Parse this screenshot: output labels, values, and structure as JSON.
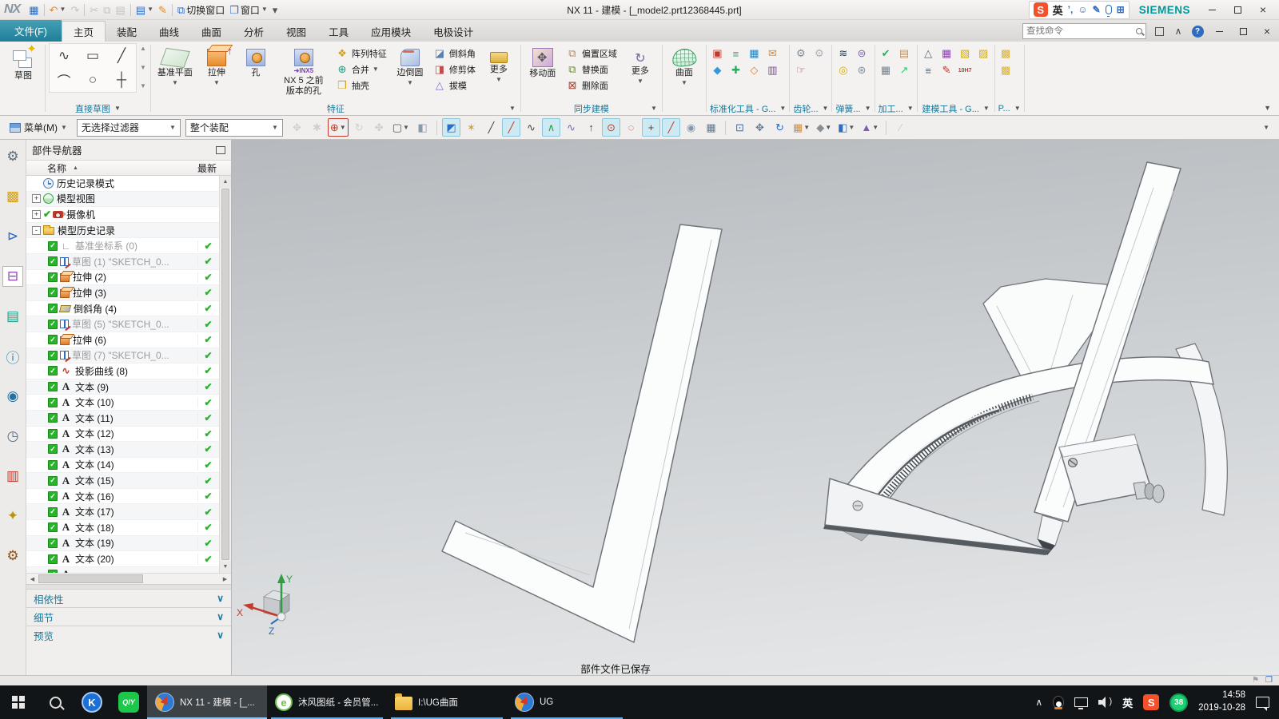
{
  "title_bar": {
    "logo": "NX",
    "title": "NX 11 - 建模 - [_model2.prt12368445.prt]",
    "qat": [
      {
        "name": "save-button",
        "glyph": "▦",
        "color": "#2d6cc0"
      },
      {
        "name": "sep"
      },
      {
        "name": "undo-button",
        "glyph": "↶",
        "color": "#e08a2e",
        "caret": true
      },
      {
        "name": "redo-button",
        "glyph": "↷",
        "color": "#888",
        "dim": true
      },
      {
        "name": "sep"
      },
      {
        "name": "cut-button",
        "glyph": "✂",
        "color": "#888",
        "dim": true
      },
      {
        "name": "copy-button",
        "glyph": "⧉",
        "color": "#888",
        "dim": true
      },
      {
        "name": "paste-button",
        "glyph": "▤",
        "color": "#888",
        "dim": true
      },
      {
        "name": "sep"
      },
      {
        "name": "format-painter-button",
        "glyph": "▤",
        "color": "#2d6cc0",
        "caret": true
      },
      {
        "name": "sweep-button",
        "glyph": "✎",
        "color": "#e08a2e"
      },
      {
        "name": "sep"
      },
      {
        "name": "switch-window-button",
        "glyph": "⧉",
        "color": "#2d6cc0",
        "label": "切换窗口"
      },
      {
        "name": "window-button",
        "glyph": "❒",
        "color": "#2d6cc0",
        "label": "窗口",
        "caret": true
      },
      {
        "name": "qat-overflow-button",
        "glyph": "▾",
        "color": "#555"
      }
    ],
    "ime": {
      "sogou": "S",
      "lang": "英",
      "punct": "’,",
      "smiley": "☺",
      "pen": "✎",
      "grid": "⊞"
    },
    "brand": "SIEMENS"
  },
  "ribbon_tabs": [
    {
      "label": "文件(F)",
      "file": true
    },
    {
      "label": "主页",
      "active": true
    },
    {
      "label": "装配"
    },
    {
      "label": "曲线"
    },
    {
      "label": "曲面"
    },
    {
      "label": "分析"
    },
    {
      "label": "视图"
    },
    {
      "label": "工具"
    },
    {
      "label": "应用模块"
    },
    {
      "label": "电极设计"
    }
  ],
  "find_command": {
    "placeholder": "查找命令"
  },
  "ribbon": {
    "sketch": {
      "label": "草图",
      "group": "直接草图",
      "cells": [
        "∿",
        "▭",
        "╱",
        "⌒",
        "○",
        "┼"
      ]
    },
    "feature": {
      "datum_plane": "基准平面",
      "extrude": "拉伸",
      "hole": "孔",
      "legacy_hole": "NX 5 之前 版本的孔",
      "legacy_tag": "➜INX5",
      "pattern": "阵列特征",
      "unite": "合并",
      "shell": "抽壳",
      "edge_blend": "边倒圆",
      "chamfer": "倒斜角",
      "trim_body": "修剪体",
      "draft": "拔模",
      "more": "更多",
      "label": "特征"
    },
    "sync": {
      "move_face": "移动面",
      "offset_region": "偏置区域",
      "replace_face": "替换面",
      "delete_face": "删除面",
      "more": "更多",
      "label": "同步建模"
    },
    "surface": {
      "label": "曲面"
    },
    "toolbox": [
      {
        "name": "standard-tools-group",
        "label": "标准化工具 - G...",
        "rows": [
          [
            [
              "▣",
              "#c0392b"
            ],
            [
              "≡",
              "#27ae60"
            ],
            [
              "▦",
              "#2980b9"
            ],
            [
              "✉",
              "#d2883a"
            ]
          ],
          [
            [
              "◆",
              "#3498db"
            ],
            [
              "✚",
              "#27ae60"
            ],
            [
              "◇",
              "#e67e22"
            ],
            [
              "▥",
              "#8e44ad"
            ]
          ]
        ]
      },
      {
        "name": "gear-group",
        "label": "齿轮...",
        "rows": [
          [
            [
              "⚙",
              "#808b96"
            ],
            [
              "⚙",
              "#aab4bd"
            ]
          ],
          [
            [
              "☞",
              "#b03a2e"
            ]
          ]
        ]
      },
      {
        "name": "spring-group",
        "label": "弹簧...",
        "rows": [
          [
            [
              "≋",
              "#2e4053"
            ],
            [
              "⊜",
              "#7d5fb2"
            ]
          ],
          [
            [
              "◎",
              "#d4ac0d"
            ],
            [
              "⊛",
              "#85929e"
            ]
          ]
        ]
      },
      {
        "name": "machining-group",
        "label": "加工...",
        "rows": [
          [
            [
              "✔",
              "#27ae60"
            ],
            [
              "▤",
              "#b9946f"
            ]
          ],
          [
            [
              "▦",
              "#76848f"
            ],
            [
              "↗",
              "#2ecc71"
            ]
          ]
        ]
      },
      {
        "name": "modeling-tools-group",
        "label": "建模工具 - G...",
        "rows": [
          [
            [
              "△",
              "#566573"
            ],
            [
              "▦",
              "#8e44ad"
            ],
            [
              "▧",
              "#d4ac0d"
            ],
            [
              "▨",
              "#d4ac0d"
            ]
          ],
          [
            [
              "≡",
              "#566573"
            ],
            [
              "✎",
              "#b03a2e"
            ],
            [
              "10H7",
              "#c0392b",
              "txt"
            ]
          ]
        ]
      },
      {
        "name": "extra-group",
        "label": "P...",
        "rows": [
          [
            [
              "▩",
              "#d9b23a"
            ]
          ],
          [
            [
              "▩",
              "#d9b23a"
            ]
          ]
        ]
      }
    ]
  },
  "selection_bar": {
    "menu": "菜单(M)",
    "filter": "无选择过滤器",
    "scope": "整个装配",
    "icons": [
      {
        "name": "feature-filter-icon",
        "glyph": "✥",
        "color": "#9aa7b0",
        "dim": true
      },
      {
        "name": "general-selection-icon",
        "glyph": "✱",
        "color": "#9aa7b0",
        "dim": true
      },
      {
        "name": "snap-options-icon",
        "glyph": "⊕",
        "color": "#c0392b",
        "caret": true,
        "frame": true
      },
      {
        "name": "rotate-selection-icon",
        "glyph": "↻",
        "color": "#9aa7b0",
        "dim": true
      },
      {
        "name": "hand-selection-icon",
        "glyph": "✤",
        "color": "#9aa7b0",
        "dim": true
      },
      {
        "name": "rectangle-select-icon",
        "glyph": "▢",
        "color": "#555",
        "caret": true
      },
      {
        "name": "shaded-select-icon",
        "glyph": "◧",
        "color": "#8899aa"
      },
      {
        "sep": true
      },
      {
        "name": "snap-enable-icon",
        "glyph": "◩",
        "color": "#2d6cc0",
        "hl": true
      },
      {
        "name": "snap-point-icon",
        "glyph": "✶",
        "color": "#caa63d"
      },
      {
        "name": "snap-endpoint-icon",
        "glyph": "╱",
        "color": "#444"
      },
      {
        "name": "snap-midpoint-icon",
        "glyph": "╱",
        "color": "#c0392b",
        "hl": true
      },
      {
        "name": "snap-tangent-icon",
        "glyph": "∿",
        "color": "#444"
      },
      {
        "name": "snap-spline-point-icon",
        "glyph": "∧",
        "color": "#2d9a4a",
        "hl": true
      },
      {
        "name": "snap-pole-icon",
        "glyph": "∿",
        "color": "#7d5fb2"
      },
      {
        "name": "snap-vertex-icon",
        "glyph": "↑",
        "color": "#444"
      },
      {
        "name": "snap-arc-center-icon",
        "glyph": "⊙",
        "color": "#c0392b",
        "hl": true
      },
      {
        "name": "snap-quadrant-icon",
        "glyph": "◌",
        "color": "#c0392b"
      },
      {
        "name": "snap-intersection-icon",
        "glyph": "+",
        "color": "#444",
        "hl": true
      },
      {
        "name": "snap-point-on-curve-icon",
        "glyph": "╱",
        "color": "#c0392b",
        "hl": true
      },
      {
        "name": "snap-face-icon",
        "glyph": "◉",
        "color": "#8899aa"
      },
      {
        "name": "snap-grid-icon",
        "glyph": "▦",
        "color": "#667788"
      },
      {
        "sep": true
      },
      {
        "name": "zoom-box-icon",
        "glyph": "⊡",
        "color": "#2d6cc0"
      },
      {
        "name": "pan-icon",
        "glyph": "✥",
        "color": "#667788"
      },
      {
        "name": "rotate-view-icon",
        "glyph": "↻",
        "color": "#2d6cc0"
      },
      {
        "name": "orient-view-icon",
        "glyph": "▦",
        "color": "#e08a2e",
        "caret": true
      },
      {
        "name": "render-style-icon",
        "glyph": "◆",
        "color": "#8a8f94",
        "caret": true
      },
      {
        "name": "view-cube-icon",
        "glyph": "◧",
        "color": "#2d6cc0",
        "caret": true
      },
      {
        "name": "visualization-icon",
        "glyph": "▲",
        "color": "#7d5fb2",
        "caret": true
      },
      {
        "sep": true
      },
      {
        "name": "measure-icon",
        "glyph": "∕",
        "color": "#999",
        "dim": true
      }
    ]
  },
  "rail": [
    {
      "name": "roles-tab",
      "glyph": "⚙",
      "color": "#5d6d7e"
    },
    {
      "name": "assembly-navigator-tab",
      "glyph": "▩",
      "color": "#d4a017"
    },
    {
      "name": "constraint-navigator-tab",
      "glyph": "⊳",
      "color": "#2d6cc0"
    },
    {
      "name": "part-navigator-tab",
      "glyph": "⊟",
      "color": "#8e44ad",
      "active": true
    },
    {
      "name": "reuse-library-tab",
      "glyph": "▤",
      "color": "#16a085"
    },
    {
      "name": "hd3d-tool-tab",
      "glyph": "ⓘ",
      "color": "#2980b9"
    },
    {
      "name": "web-browser-tab",
      "glyph": "◉",
      "color": "#2471a3"
    },
    {
      "name": "history-tab",
      "glyph": "◷",
      "color": "#5d6d7e"
    },
    {
      "name": "palette-tab",
      "glyph": "▥",
      "color": "#c0392b"
    },
    {
      "name": "process-studio-tab",
      "glyph": "✦",
      "color": "#b7950b"
    },
    {
      "name": "tools-tab",
      "glyph": "⚙",
      "color": "#935116"
    }
  ],
  "navigator": {
    "title": "部件导航器",
    "col_name": "名称",
    "col_latest": "最新",
    "items": [
      {
        "label": "历史记录模式",
        "icon": "clock",
        "root": true
      },
      {
        "label": "模型视图",
        "icon": "mview",
        "root": true,
        "expand": "+"
      },
      {
        "label": "摄像机",
        "icon": "camera",
        "root": true,
        "expand": "+",
        "pre": true
      },
      {
        "label": "模型历史记录",
        "icon": "folder",
        "root": true,
        "expand": "-"
      },
      {
        "label": "基准坐标系 (0)",
        "icon": "csys",
        "cb": true,
        "gray": true,
        "latest": true
      },
      {
        "label": "草图 (1) \"SKETCH_0...",
        "icon": "sketch",
        "cb": true,
        "gray": true,
        "latest": true
      },
      {
        "label": "拉伸 (2)",
        "icon": "extrude",
        "cb": true,
        "latest": true
      },
      {
        "label": "拉伸 (3)",
        "icon": "extrude",
        "cb": true,
        "latest": true
      },
      {
        "label": "倒斜角 (4)",
        "icon": "chamfer",
        "cb": true,
        "latest": true
      },
      {
        "label": "草图 (5) \"SKETCH_0...",
        "icon": "sketch",
        "cb": true,
        "gray": true,
        "latest": true
      },
      {
        "label": "拉伸 (6)",
        "icon": "extrude",
        "cb": true,
        "latest": true
      },
      {
        "label": "草图 (7) \"SKETCH_0...",
        "icon": "sketch",
        "cb": true,
        "gray": true,
        "latest": true
      },
      {
        "label": "投影曲线 (8)",
        "icon": "pcurve",
        "cb": true,
        "latest": true
      },
      {
        "label": "文本 (9)",
        "icon": "text",
        "cb": true,
        "latest": true
      },
      {
        "label": "文本 (10)",
        "icon": "text",
        "cb": true,
        "latest": true
      },
      {
        "label": "文本 (11)",
        "icon": "text",
        "cb": true,
        "latest": true
      },
      {
        "label": "文本 (12)",
        "icon": "text",
        "cb": true,
        "latest": true
      },
      {
        "label": "文本 (13)",
        "icon": "text",
        "cb": true,
        "latest": true
      },
      {
        "label": "文本 (14)",
        "icon": "text",
        "cb": true,
        "latest": true
      },
      {
        "label": "文本 (15)",
        "icon": "text",
        "cb": true,
        "latest": true
      },
      {
        "label": "文本 (16)",
        "icon": "text",
        "cb": true,
        "latest": true
      },
      {
        "label": "文本 (17)",
        "icon": "text",
        "cb": true,
        "latest": true
      },
      {
        "label": "文本 (18)",
        "icon": "text",
        "cb": true,
        "latest": true
      },
      {
        "label": "文本 (19)",
        "icon": "text",
        "cb": true,
        "latest": true
      },
      {
        "label": "文本 (20)",
        "icon": "text",
        "cb": true,
        "latest": true
      },
      {
        "label": "",
        "icon": "text",
        "cb": true,
        "partial": true
      }
    ],
    "panels": [
      {
        "label": "相依性"
      },
      {
        "label": "细节"
      },
      {
        "label": "预览"
      }
    ]
  },
  "viewport": {
    "status_message": "部件文件已保存",
    "triad": {
      "x": "X",
      "y": "Y",
      "z": "Z"
    }
  },
  "status_strip": {
    "icons": [
      {
        "name": "status-flag-icon",
        "glyph": "⚑",
        "color": "#9aa0a6"
      },
      {
        "name": "status-window-icon",
        "glyph": "❒",
        "color": "#2d6cc0"
      }
    ]
  },
  "taskbar": {
    "pinned": [
      {
        "name": "kuaishou-app",
        "label": "K"
      },
      {
        "name": "iqiyi-app",
        "label": "QIY"
      }
    ],
    "tasks": [
      {
        "name": "task-nx",
        "label": "NX 11 - 建模 - [_...",
        "icon": "nx",
        "active": true
      },
      {
        "name": "task-browser",
        "label": "沐风图纸 - 会员管...",
        "icon": "mufeng"
      },
      {
        "name": "task-explorer",
        "label": "I:\\UG曲面",
        "icon": "folder"
      },
      {
        "name": "task-ug",
        "label": "UG",
        "icon": "nx"
      }
    ],
    "tray": {
      "lang": "英",
      "sogou": "S",
      "badge": "38",
      "time": "14:58",
      "date": "2019-10-28"
    }
  }
}
